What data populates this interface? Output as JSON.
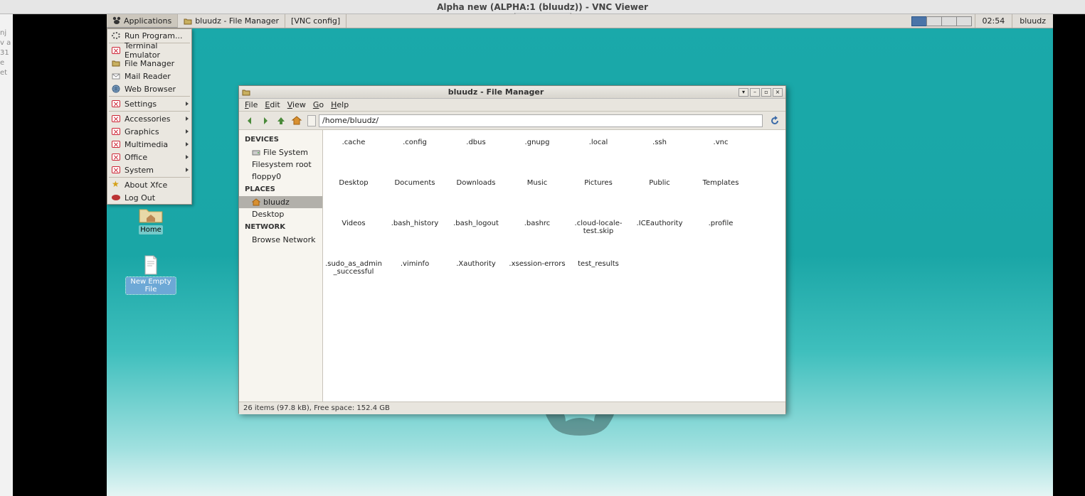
{
  "host_title": "Alpha new (ALPHA:1 (bluudz)) - VNC Viewer",
  "left_strip": "nj\n\nv\na\n\n31\ne\net",
  "panel": {
    "app_btn": "Applications",
    "task1": "bluudz - File Manager",
    "task2": "[VNC config]",
    "clock": "02:54",
    "user": "bluudz"
  },
  "menu": {
    "run": "Run Program...",
    "terminal": "Terminal Emulator",
    "filemgr": "File Manager",
    "mail": "Mail Reader",
    "web": "Web Browser",
    "settings": "Settings",
    "accessories": "Accessories",
    "graphics": "Graphics",
    "multimedia": "Multimedia",
    "office": "Office",
    "system": "System",
    "about": "About Xfce",
    "logout": "Log Out"
  },
  "desk": {
    "home": "Home",
    "newfile": "New Empty File"
  },
  "fm": {
    "title": "bluudz - File Manager",
    "menus": {
      "file": "File",
      "edit": "Edit",
      "view": "View",
      "go": "Go",
      "help": "Help"
    },
    "path": "/home/bluudz/",
    "side": {
      "devices": "DEVICES",
      "fs": "File System",
      "fsroot": "Filesystem root",
      "floppy": "floppy0",
      "places": "PLACES",
      "bluudz": "bluudz",
      "desktop": "Desktop",
      "network": "NETWORK",
      "browse": "Browse Network"
    },
    "files": [
      ".cache",
      ".config",
      ".dbus",
      ".gnupg",
      ".local",
      ".ssh",
      ".vnc",
      "Desktop",
      "Documents",
      "Downloads",
      "Music",
      "Pictures",
      "Public",
      "Templates",
      "Videos",
      ".bash_history",
      ".bash_logout",
      ".bashrc",
      ".cloud-locale-test.skip",
      ".ICEauthority",
      ".profile",
      ".sudo_as_admin_successful",
      ".viminfo",
      ".Xauthority",
      ".xsession-errors",
      "test_results"
    ],
    "status": "26 items (97.8 kB), Free space: 152.4 GB"
  }
}
